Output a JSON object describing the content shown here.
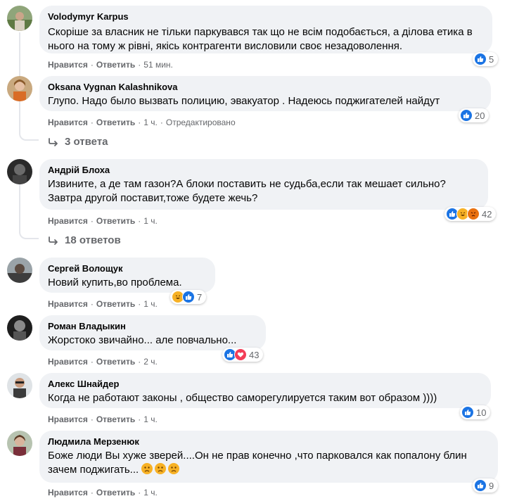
{
  "labels": {
    "like": "Нравится",
    "reply": "Ответить",
    "sep": "·"
  },
  "comments": [
    {
      "author": "Volodymyr Karpus",
      "text": "Скоріше за власник не тільки паркувався так що не всім подобається, а ділова етика в нього на тому ж рівні, якісь контрагенти висловили своє незадоволення.",
      "time": "51 мин.",
      "edited": "",
      "reactions": "5"
    },
    {
      "author": "Oksana Vygnan Kalashnikova",
      "text": "Глупо. Надо было вызвать полицию, эвакуатор . Надеюсь поджигателей найдут",
      "time": "1 ч.",
      "edited": "Отредактировано",
      "reactions": "20",
      "replies": "3 ответа"
    },
    {
      "author": "Андрій Блоха",
      "text": "Извините, а де там газон?А блоки поставить не судьба,если так мешает сильно? Завтра другой поставит,тоже будете жечь?",
      "time": "1 ч.",
      "edited": "",
      "reactions": "42",
      "replies": "18 ответов"
    },
    {
      "author": "Сергей Волощук",
      "text": "Новий купить,во проблема.",
      "time": "1 ч.",
      "edited": "",
      "reactions": "7"
    },
    {
      "author": "Роман Владыкин",
      "text": "Жорстоко звичайно... але повчально...",
      "time": "2 ч.",
      "edited": "",
      "reactions": "43"
    },
    {
      "author": "Алекс Шнайдер",
      "text": "Когда не работают законы , общество саморегулируется таким вот образом ))))",
      "time": "1 ч.",
      "edited": "",
      "reactions": "10"
    },
    {
      "author": "Людмила Мерзенюк",
      "text": "Боже люди Вы хуже зверей....Он не прав конечно ,что парковался как попалону блин зачем поджигать...",
      "time": "1 ч.",
      "edited": "",
      "reactions": "9"
    }
  ],
  "icons": {
    "like": "like-icon",
    "haha": "haha-icon",
    "angry": "angry-icon",
    "love": "love-icon",
    "sad": "sad-emoji-icon",
    "reply_arrow": "reply-arrow-icon"
  },
  "colors": {
    "like": "#1b74e4",
    "haha": "#f7b125",
    "angry": "#e9710f",
    "love": "#f33e58",
    "meta": "#65676b",
    "bubble": "#f0f2f5"
  }
}
